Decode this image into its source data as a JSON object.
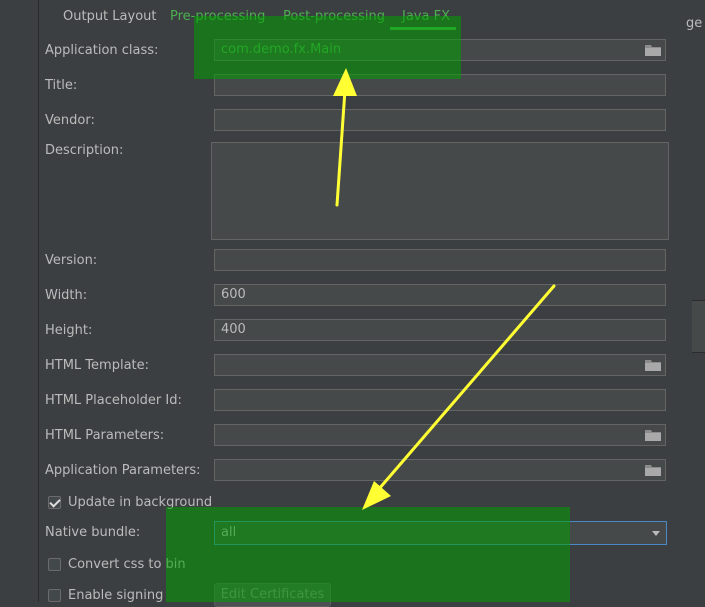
{
  "tabs": [
    {
      "label": "Output Layout",
      "color": "default"
    },
    {
      "label": "Pre-processing",
      "color": "green"
    },
    {
      "label": "Post-processing",
      "color": "green"
    },
    {
      "label": "Java FX",
      "color": "green",
      "active": true
    }
  ],
  "right_fragment": "ge",
  "fields": {
    "application_class": {
      "label": "Application class:",
      "value": "com.demo.fx.Main",
      "icon": "folder-icon"
    },
    "title": {
      "label": "Title:",
      "value": ""
    },
    "vendor": {
      "label": "Vendor:",
      "value": ""
    },
    "description": {
      "label": "Description:",
      "value": ""
    },
    "version": {
      "label": "Version:",
      "value": ""
    },
    "width": {
      "label": "Width:",
      "value": "600"
    },
    "height": {
      "label": "Height:",
      "value": "400"
    },
    "html_template": {
      "label": "HTML Template:",
      "value": "",
      "icon": "folder-icon"
    },
    "html_placeholder_id": {
      "label": "HTML Placeholder Id:",
      "value": ""
    },
    "html_parameters": {
      "label": "HTML Parameters:",
      "value": "",
      "icon": "folder-icon"
    },
    "application_parameters": {
      "label": "Application Parameters:",
      "value": "",
      "icon": "folder-icon"
    }
  },
  "update_in_background": {
    "label": "Update in background",
    "checked": true
  },
  "native_bundle": {
    "label": "Native bundle:",
    "value": "all"
  },
  "convert_css": {
    "label": "Convert css to bin",
    "checked": false
  },
  "enable_signing": {
    "label": "Enable signing",
    "checked": false
  },
  "edit_certificates": {
    "label": "Edit Certificates"
  },
  "colors": {
    "highlight": "#00a000",
    "arrow": "#ffff33",
    "accent": "#4caf50"
  }
}
